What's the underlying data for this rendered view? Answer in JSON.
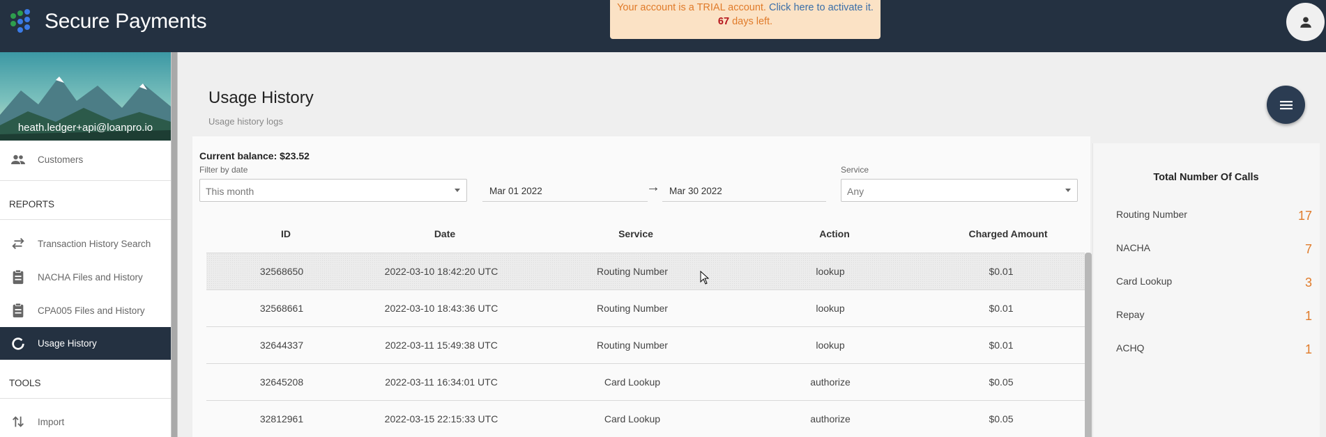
{
  "header": {
    "brand": "Secure Payments",
    "trial_text": "Your account is a TRIAL account.",
    "trial_link": "Click here to activate it.",
    "days_left": "67",
    "days_suffix": "days left."
  },
  "sidebar": {
    "user_email": "heath.ledger+api@loanpro.io",
    "customers_label": "Customers",
    "reports_heading": "REPORTS",
    "tools_heading": "TOOLS",
    "items": [
      {
        "label": "Transaction History Search",
        "icon": "swap-arrows-icon"
      },
      {
        "label": "NACHA Files and History",
        "icon": "clipboard-icon"
      },
      {
        "label": "CPA005 Files and History",
        "icon": "clipboard-icon"
      },
      {
        "label": "Usage History",
        "icon": "donut-icon"
      }
    ],
    "import_label": "Import"
  },
  "page": {
    "title": "Usage History",
    "subtitle": "Usage history logs"
  },
  "filters": {
    "balance": "Current balance: $23.52",
    "filter_label": "Filter by date",
    "filter_value": "This month",
    "date_from": "Mar 01 2022",
    "date_to": "Mar 30 2022",
    "arrow": "→",
    "service_label": "Service",
    "service_value": "Any"
  },
  "table": {
    "columns": [
      "ID",
      "Date",
      "Service",
      "Action",
      "Charged Amount"
    ],
    "rows": [
      {
        "id": "32568650",
        "date": "2022-03-10 18:42:20 UTC",
        "service": "Routing Number",
        "action": "lookup",
        "amount": "$0.01"
      },
      {
        "id": "32568661",
        "date": "2022-03-10 18:43:36 UTC",
        "service": "Routing Number",
        "action": "lookup",
        "amount": "$0.01"
      },
      {
        "id": "32644337",
        "date": "2022-03-11 15:49:38 UTC",
        "service": "Routing Number",
        "action": "lookup",
        "amount": "$0.01"
      },
      {
        "id": "32645208",
        "date": "2022-03-11 16:34:01 UTC",
        "service": "Card Lookup",
        "action": "authorize",
        "amount": "$0.05"
      },
      {
        "id": "32812961",
        "date": "2022-03-15 22:15:33 UTC",
        "service": "Card Lookup",
        "action": "authorize",
        "amount": "$0.05"
      }
    ]
  },
  "totals": {
    "title": "Total Number Of Calls",
    "items": [
      {
        "label": "Routing Number",
        "count": "17"
      },
      {
        "label": "NACHA",
        "count": "7"
      },
      {
        "label": "Card Lookup",
        "count": "3"
      },
      {
        "label": "Repay",
        "count": "1"
      },
      {
        "label": "ACHQ",
        "count": "1"
      }
    ]
  },
  "colors": {
    "navy": "#243141",
    "accent_orange": "#e07b2a",
    "trial_bg": "#fbe2c5"
  }
}
